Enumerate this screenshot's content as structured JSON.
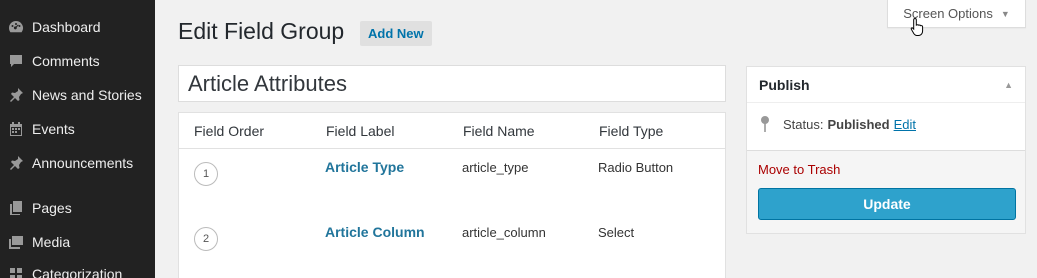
{
  "sidebar": {
    "items": [
      {
        "label": "Dashboard",
        "icon": "dashboard-icon"
      },
      {
        "label": "Comments",
        "icon": "comment-icon"
      },
      {
        "label": "News and Stories",
        "icon": "pin-icon"
      },
      {
        "label": "Events",
        "icon": "calendar-icon"
      },
      {
        "label": "Announcements",
        "icon": "pin-icon"
      },
      {
        "label": "Pages",
        "icon": "pages-icon"
      },
      {
        "label": "Media",
        "icon": "media-icon"
      },
      {
        "label": "Categorization",
        "icon": "category-icon"
      }
    ]
  },
  "screen_options": {
    "label": "Screen Options"
  },
  "header": {
    "title": "Edit Field Group",
    "add_new": "Add New"
  },
  "group_title": {
    "value": "Article Attributes"
  },
  "fields": {
    "columns": [
      "Field Order",
      "Field Label",
      "Field Name",
      "Field Type"
    ],
    "rows": [
      {
        "order": "1",
        "label": "Article Type",
        "name": "article_type",
        "type": "Radio Button"
      },
      {
        "order": "2",
        "label": "Article Column",
        "name": "article_column",
        "type": "Select"
      }
    ]
  },
  "publish": {
    "title": "Publish",
    "status_label": "Status:",
    "status_value": "Published",
    "edit_link": "Edit",
    "trash_link": "Move to Trash",
    "update_button": "Update"
  },
  "colors": {
    "sidebar_bg": "#222222",
    "link": "#21759b",
    "primary_button": "#2ea2cc",
    "trash": "#aa0000"
  }
}
